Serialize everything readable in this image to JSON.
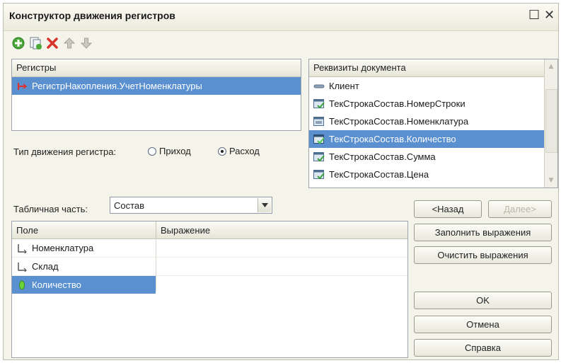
{
  "window": {
    "title": "Конструктор движения регистров"
  },
  "toolbar": {
    "icons": [
      "add-icon",
      "copy-icon",
      "delete-icon",
      "move-up-icon",
      "move-down-icon"
    ]
  },
  "registers": {
    "header": "Регистры",
    "items": [
      {
        "label": "РегистрНакопления.УчетНоменклатуры",
        "selected": true
      }
    ]
  },
  "movement_type": {
    "label": "Тип движения регистра:",
    "options": [
      {
        "label": "Приход",
        "checked": false
      },
      {
        "label": "Расход",
        "checked": true
      }
    ]
  },
  "doc_attributes": {
    "header": "Реквизиты документа",
    "items": [
      {
        "label": "Клиент",
        "icon": "attribute-icon",
        "selected": false
      },
      {
        "label": "ТекСтрокаСостав.НомерСтроки",
        "icon": "table-field-icon",
        "selected": false
      },
      {
        "label": "ТекСтрокаСостав.Номенклатура",
        "icon": "table-field-icon",
        "selected": false
      },
      {
        "label": "ТекСтрокаСостав.Количество",
        "icon": "table-field-icon",
        "selected": true
      },
      {
        "label": "ТекСтрокаСостав.Сумма",
        "icon": "table-field-icon",
        "selected": false
      },
      {
        "label": "ТекСтрокаСостав.Цена",
        "icon": "table-field-icon",
        "selected": false
      }
    ]
  },
  "tabular": {
    "label": "Табличная часть:",
    "value": "Состав"
  },
  "fields_table": {
    "columns": [
      "Поле",
      "Выражение"
    ],
    "rows": [
      {
        "field": "Номенклатура",
        "expression": "",
        "icon": "dimension-icon",
        "selected": false
      },
      {
        "field": "Склад",
        "expression": "",
        "icon": "dimension-icon",
        "selected": false
      },
      {
        "field": "Количество",
        "expression": "",
        "icon": "resource-icon",
        "selected": true
      }
    ]
  },
  "buttons": {
    "back": "<Назад",
    "next": "Далее>",
    "fill": "Заполнить выражения",
    "clear": "Очистить выражения",
    "ok": "OK",
    "cancel": "Отмена",
    "help": "Справка"
  },
  "colors": {
    "selection": "#5a8fd0",
    "window_bg": "#f5f4ea",
    "delete_icon": "#d8342c",
    "add_icon": "#4aa83a"
  }
}
